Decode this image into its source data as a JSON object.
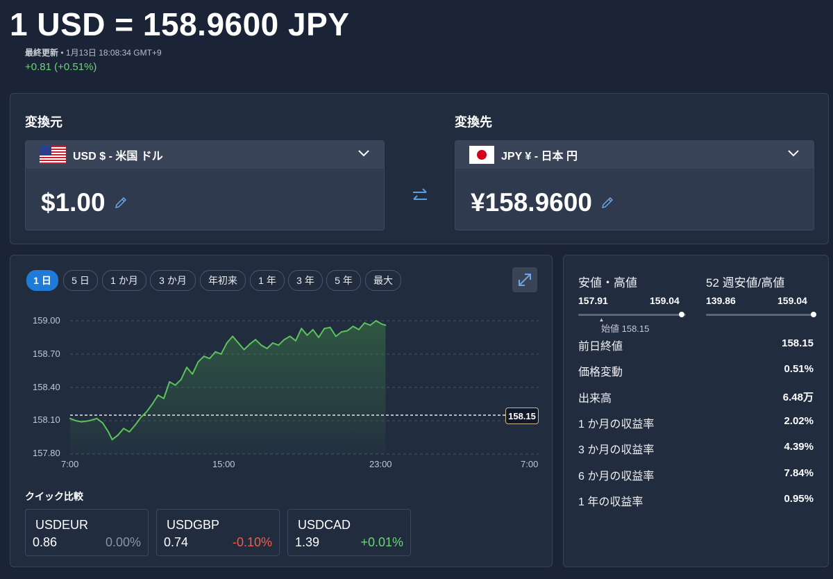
{
  "header": {
    "title": "1 USD = 158.9600 JPY",
    "updated_label": "最終更新",
    "updated_time": "• 1月13日 18:08:34 GMT+9",
    "change": "+0.81 (+0.51%)"
  },
  "converter": {
    "from_label": "変換元",
    "to_label": "変換先",
    "from_currency": "USD $ - 米国 ドル",
    "to_currency": "JPY ¥ - 日本 円",
    "from_amount": "$1.00",
    "to_amount": "¥158.9600"
  },
  "ranges": [
    "1 日",
    "5 日",
    "1 か月",
    "3 か月",
    "年初来",
    "1 年",
    "3 年",
    "5 年",
    "最大"
  ],
  "active_range": "1 日",
  "chart_data": {
    "type": "area",
    "y_ticks": [
      "159.00",
      "158.70",
      "158.40",
      "158.10",
      "157.80"
    ],
    "x_ticks": [
      "7:00",
      "15:00",
      "23:00",
      "7:00"
    ],
    "ylim": [
      157.8,
      159.0
    ],
    "x_range_hours": [
      0,
      24
    ],
    "reference": {
      "label": "158.15",
      "value": 158.15
    },
    "line_color": "#5cc25a",
    "series": [
      {
        "values": [
          [
            0.0,
            158.12
          ],
          [
            0.3,
            158.1
          ],
          [
            0.6,
            158.09
          ],
          [
            1.0,
            158.1
          ],
          [
            1.4,
            158.12
          ],
          [
            1.7,
            158.08
          ],
          [
            2.0,
            158.0
          ],
          [
            2.2,
            157.93
          ],
          [
            2.5,
            157.97
          ],
          [
            2.8,
            158.03
          ],
          [
            3.1,
            158.0
          ],
          [
            3.4,
            158.06
          ],
          [
            3.7,
            158.13
          ],
          [
            4.0,
            158.18
          ],
          [
            4.3,
            158.25
          ],
          [
            4.6,
            158.33
          ],
          [
            4.9,
            158.3
          ],
          [
            5.2,
            158.45
          ],
          [
            5.5,
            158.42
          ],
          [
            5.8,
            158.47
          ],
          [
            6.1,
            158.58
          ],
          [
            6.4,
            158.52
          ],
          [
            6.7,
            158.63
          ],
          [
            7.0,
            158.68
          ],
          [
            7.3,
            158.66
          ],
          [
            7.6,
            158.72
          ],
          [
            7.9,
            158.7
          ],
          [
            8.2,
            158.8
          ],
          [
            8.5,
            158.86
          ],
          [
            8.8,
            158.8
          ],
          [
            9.1,
            158.74
          ],
          [
            9.4,
            158.79
          ],
          [
            9.7,
            158.83
          ],
          [
            10.0,
            158.78
          ],
          [
            10.3,
            158.75
          ],
          [
            10.6,
            158.8
          ],
          [
            10.9,
            158.78
          ],
          [
            11.2,
            158.83
          ],
          [
            11.5,
            158.86
          ],
          [
            11.8,
            158.82
          ],
          [
            12.1,
            158.93
          ],
          [
            12.4,
            158.87
          ],
          [
            12.7,
            158.92
          ],
          [
            13.0,
            158.85
          ],
          [
            13.3,
            158.93
          ],
          [
            13.6,
            158.94
          ],
          [
            13.9,
            158.86
          ],
          [
            14.2,
            158.9
          ],
          [
            14.5,
            158.91
          ],
          [
            14.8,
            158.95
          ],
          [
            15.1,
            158.92
          ],
          [
            15.4,
            158.98
          ],
          [
            15.7,
            158.96
          ],
          [
            16.0,
            159.0
          ],
          [
            16.3,
            158.97
          ],
          [
            16.5,
            158.96
          ]
        ]
      }
    ]
  },
  "quick_compare": {
    "title": "クイック比較",
    "items": [
      {
        "symbol": "USDEUR",
        "value": "0.86",
        "change": "0.00%",
        "color": "#8c93a2"
      },
      {
        "symbol": "USDGBP",
        "value": "0.74",
        "change": "-0.10%",
        "color": "#f25a4a"
      },
      {
        "symbol": "USDCAD",
        "value": "1.39",
        "change": "+0.01%",
        "color": "#6cd473"
      }
    ]
  },
  "stats": {
    "range_title": "安値・高値",
    "range_low": "157.91",
    "range_high": "159.04",
    "open_label": "始値 158.15",
    "week52_title": "52 週安値/高値",
    "week52_low": "139.86",
    "week52_high": "159.04",
    "range_level": 0.96,
    "week52_level": 1.0,
    "open_level": 0.21,
    "rows": [
      {
        "label": "前日終値",
        "value": "158.15"
      },
      {
        "label": "価格変動",
        "value": "0.51%"
      },
      {
        "label": "出来高",
        "value": "6.48万"
      },
      {
        "label": "1 か月の収益率",
        "value": "2.02%"
      },
      {
        "label": "3 か月の収益率",
        "value": "4.39%"
      },
      {
        "label": "6 か月の収益率",
        "value": "7.84%"
      },
      {
        "label": "1 年の収益率",
        "value": "0.95%"
      }
    ]
  }
}
